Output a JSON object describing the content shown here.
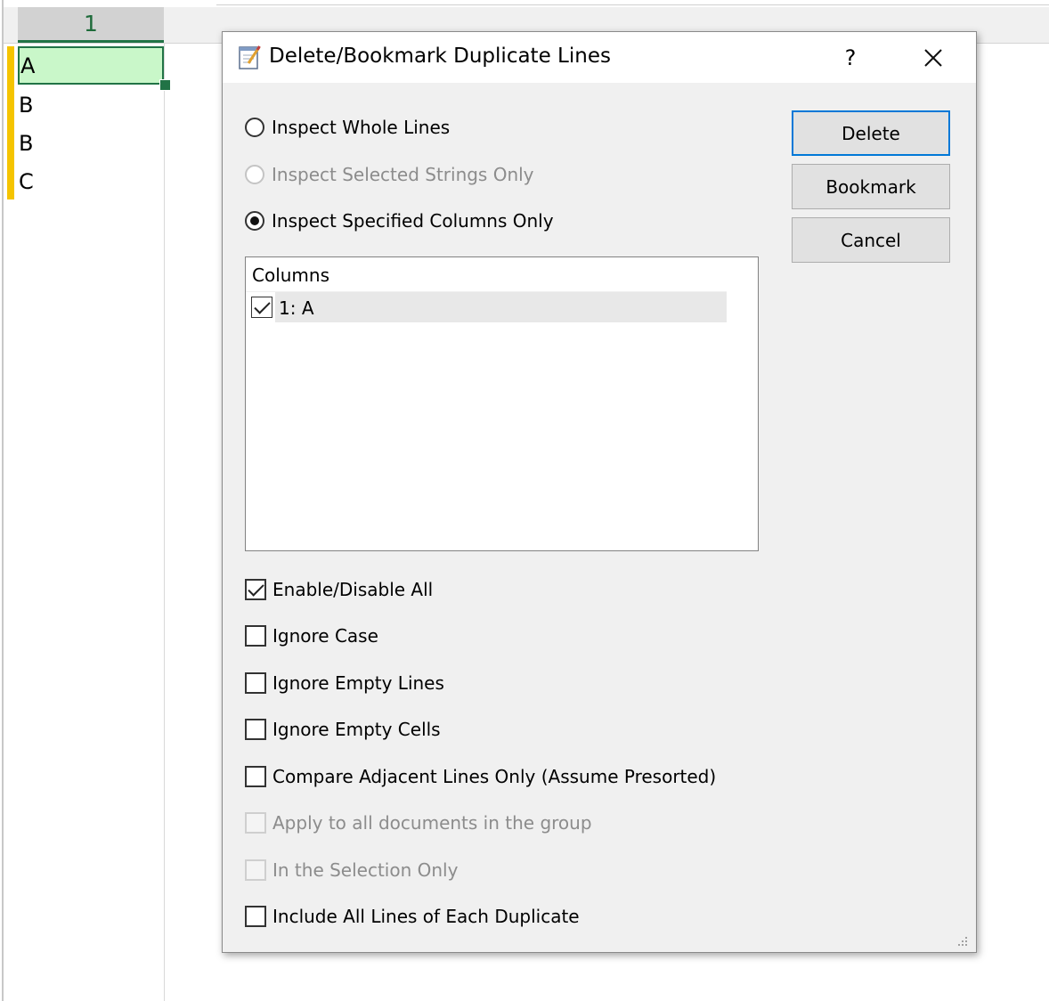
{
  "sheet": {
    "column_header": "1",
    "cells": [
      "A",
      "B",
      "B",
      "C"
    ]
  },
  "dialog": {
    "title": "Delete/Bookmark Duplicate Lines",
    "help_label": "?",
    "radios": {
      "whole_lines": "Inspect Whole Lines",
      "selected_strings": "Inspect Selected Strings Only",
      "specified_columns": "Inspect Specified Columns Only"
    },
    "columns_list": {
      "header": "Columns",
      "items": [
        "1: A"
      ]
    },
    "buttons": {
      "delete": "Delete",
      "bookmark": "Bookmark",
      "cancel": "Cancel"
    },
    "options": {
      "enable_disable_all": "Enable/Disable All",
      "ignore_case": "Ignore Case",
      "ignore_empty_lines": "Ignore Empty Lines",
      "ignore_empty_cells": "Ignore Empty Cells",
      "compare_adjacent": "Compare Adjacent Lines Only (Assume Presorted)",
      "apply_all_docs": "Apply to all documents in the group",
      "selection_only": "In the Selection Only",
      "include_all_lines": "Include All Lines of Each Duplicate"
    }
  },
  "colors": {
    "accent": "#0078d7",
    "active_cell_fill": "#c9f7c9",
    "active_cell_border": "#217346",
    "bookmark": "#f5c400"
  }
}
